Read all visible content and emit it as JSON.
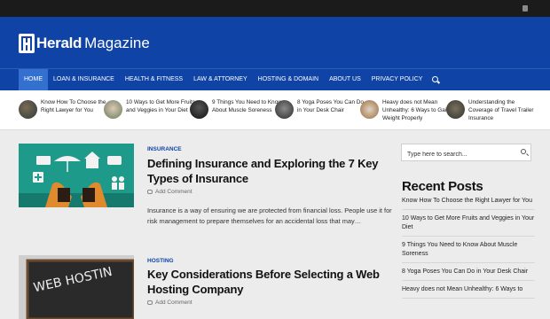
{
  "site": {
    "name_bold": "Herald",
    "name_light": "Magazine"
  },
  "colors": {
    "brand": "#0f44a6",
    "nav_active": "#3470cf",
    "topbar": "#1b1b1b"
  },
  "nav": {
    "items": [
      "HOME",
      "LOAN & INSURANCE",
      "HEALTH & FITNESS",
      "LAW & ATTORNEY",
      "HOSTING & DOMAIN",
      "ABOUT US",
      "PRIVACY POLICY"
    ],
    "active": "HOME"
  },
  "ticker": [
    {
      "title": "Know How To Choose the Right Lawyer for You"
    },
    {
      "title": "10 Ways to Get More Fruits and Veggies in Your Diet"
    },
    {
      "title": "9 Things You Need to Know About Muscle Soreness"
    },
    {
      "title": "8 Yoga Poses You Can Do in Your Desk Chair"
    },
    {
      "title": "Heavy does not Mean Unhealthy: 6 Ways to Gain Weight Properly"
    },
    {
      "title": "Understanding the Coverage of Travel Trailer Insurance"
    }
  ],
  "posts": [
    {
      "category": "INSURANCE",
      "title": "Defining Insurance and Exploring the 7 Key Types of Insurance",
      "comment_label": "Add Comment",
      "excerpt": "Insurance is a way of ensuring we are protected from financial loss. People use it for risk management to prepare themselves for an accidental loss that may…"
    },
    {
      "category": "HOSTING",
      "title": "Key Considerations Before Selecting a Web Hosting Company",
      "comment_label": "Add Comment",
      "image_text": "WEB HOSTIN"
    }
  ],
  "sidebar": {
    "search_placeholder": "Type here to search...",
    "recent_title": "Recent Posts",
    "recent_posts": [
      "Know How To Choose the Right Lawyer for You",
      "10 Ways to Get More Fruits and Veggies in Your Diet",
      "9 Things You Need to Know About Muscle Soreness",
      "8 Yoga Poses You Can Do in Your Desk Chair",
      "Heavy does not Mean Unhealthy: 6 Ways to"
    ]
  }
}
